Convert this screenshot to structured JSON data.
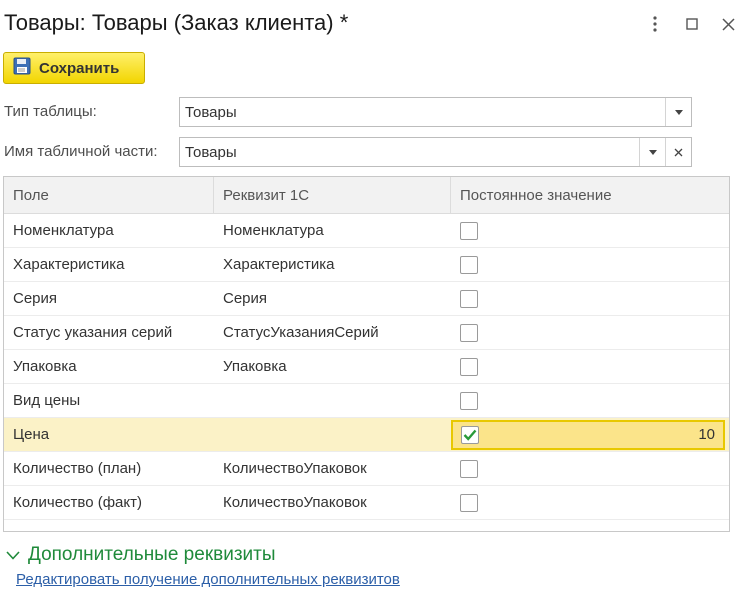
{
  "window": {
    "title": "Товары: Товары (Заказ клиента) *",
    "buttons": [
      "more-icon",
      "maximize-icon",
      "close-icon"
    ]
  },
  "toolbar": {
    "save_label": "Сохранить",
    "save_icon": "floppy-disk-icon"
  },
  "form": {
    "table_type": {
      "label": "Тип таблицы:",
      "value": "Товары"
    },
    "tabular_part": {
      "label": "Имя табличной части:",
      "value": "Товары"
    }
  },
  "grid": {
    "columns": [
      "Поле",
      "Реквизит 1С",
      "Постоянное значение"
    ],
    "rows": [
      {
        "field": "Номенклатура",
        "attr": "Номенклатура",
        "checked": false,
        "value": ""
      },
      {
        "field": "Характеристика",
        "attr": "Характеристика",
        "checked": false,
        "value": ""
      },
      {
        "field": "Серия",
        "attr": "Серия",
        "checked": false,
        "value": ""
      },
      {
        "field": "Статус указания серий",
        "attr": "СтатусУказанияСерий",
        "checked": false,
        "value": ""
      },
      {
        "field": "Упаковка",
        "attr": "Упаковка",
        "checked": false,
        "value": ""
      },
      {
        "field": "Вид цены",
        "attr": "",
        "checked": false,
        "value": ""
      },
      {
        "field": "Цена",
        "attr": "",
        "checked": true,
        "value": "10"
      },
      {
        "field": "Количество (план)",
        "attr": "КоличествоУпаковок",
        "checked": false,
        "value": ""
      },
      {
        "field": "Количество (факт)",
        "attr": "КоличествоУпаковок",
        "checked": false,
        "value": ""
      }
    ]
  },
  "section": {
    "title": "Дополнительные реквизиты",
    "expanded": true
  },
  "link": {
    "text": "Редактировать получение дополнительных реквизитов"
  },
  "colors": {
    "accent_yellow": "#f2d500",
    "selected_row": "#fbf2c7",
    "section_green": "#1f8a3a",
    "link_blue": "#2c5fa8"
  }
}
